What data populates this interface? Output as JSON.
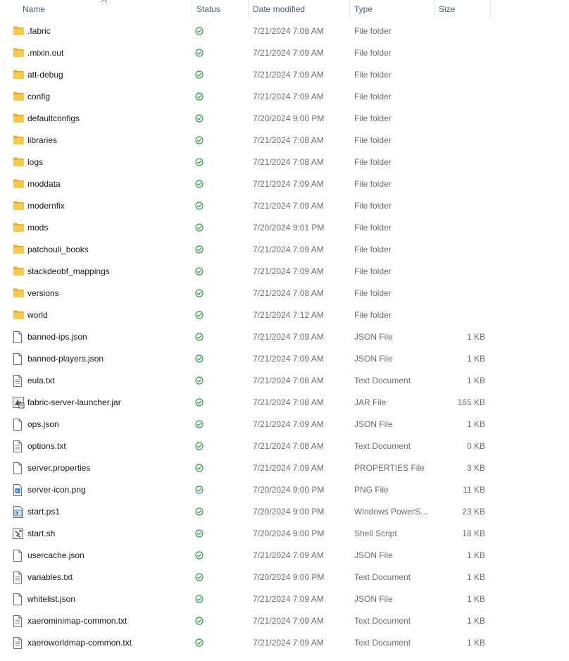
{
  "columns": {
    "name": "Name",
    "status": "Status",
    "date": "Date modified",
    "type": "Type",
    "size": "Size"
  },
  "colors": {
    "folder": "#f8c94a",
    "folder_dark": "#e6ab2a",
    "status_green": "#2e9c4a",
    "header_text": "#4c607a",
    "secondary_text": "#6d6d6d"
  },
  "files": [
    {
      "name": ".fabric",
      "icon": "folder-icon",
      "date": "7/21/2024 7:08 AM",
      "type": "File folder",
      "size": ""
    },
    {
      "name": ".mixin.out",
      "icon": "folder-icon",
      "date": "7/21/2024 7:09 AM",
      "type": "File folder",
      "size": ""
    },
    {
      "name": "att-debug",
      "icon": "folder-icon",
      "date": "7/21/2024 7:09 AM",
      "type": "File folder",
      "size": ""
    },
    {
      "name": "config",
      "icon": "folder-icon",
      "date": "7/21/2024 7:09 AM",
      "type": "File folder",
      "size": ""
    },
    {
      "name": "defaultconfigs",
      "icon": "folder-icon",
      "date": "7/20/2024 9:00 PM",
      "type": "File folder",
      "size": ""
    },
    {
      "name": "libraries",
      "icon": "folder-icon",
      "date": "7/21/2024 7:08 AM",
      "type": "File folder",
      "size": ""
    },
    {
      "name": "logs",
      "icon": "folder-icon",
      "date": "7/21/2024 7:08 AM",
      "type": "File folder",
      "size": ""
    },
    {
      "name": "moddata",
      "icon": "folder-icon",
      "date": "7/21/2024 7:09 AM",
      "type": "File folder",
      "size": ""
    },
    {
      "name": "modernfix",
      "icon": "folder-icon",
      "date": "7/21/2024 7:09 AM",
      "type": "File folder",
      "size": ""
    },
    {
      "name": "mods",
      "icon": "folder-icon",
      "date": "7/20/2024 9:01 PM",
      "type": "File folder",
      "size": ""
    },
    {
      "name": "patchouli_books",
      "icon": "folder-icon",
      "date": "7/21/2024 7:09 AM",
      "type": "File folder",
      "size": ""
    },
    {
      "name": "stackdeobf_mappings",
      "icon": "folder-icon",
      "date": "7/21/2024 7:09 AM",
      "type": "File folder",
      "size": ""
    },
    {
      "name": "versions",
      "icon": "folder-icon",
      "date": "7/21/2024 7:08 AM",
      "type": "File folder",
      "size": ""
    },
    {
      "name": "world",
      "icon": "folder-icon",
      "date": "7/21/2024 7:12 AM",
      "type": "File folder",
      "size": ""
    },
    {
      "name": "banned-ips.json",
      "icon": "document-icon",
      "date": "7/21/2024 7:09 AM",
      "type": "JSON File",
      "size": "1 KB"
    },
    {
      "name": "banned-players.json",
      "icon": "document-icon",
      "date": "7/21/2024 7:09 AM",
      "type": "JSON File",
      "size": "1 KB"
    },
    {
      "name": "eula.txt",
      "icon": "text-document-icon",
      "date": "7/21/2024 7:08 AM",
      "type": "Text Document",
      "size": "1 KB"
    },
    {
      "name": "fabric-server-launcher.jar",
      "icon": "jar-icon",
      "date": "7/21/2024 7:08 AM",
      "type": "JAR File",
      "size": "165 KB"
    },
    {
      "name": "ops.json",
      "icon": "document-icon",
      "date": "7/21/2024 7:09 AM",
      "type": "JSON File",
      "size": "1 KB"
    },
    {
      "name": "options.txt",
      "icon": "text-document-icon",
      "date": "7/21/2024 7:08 AM",
      "type": "Text Document",
      "size": "0 KB"
    },
    {
      "name": "server.properties",
      "icon": "blank-document-icon",
      "date": "7/21/2024 7:09 AM",
      "type": "PROPERTIES File",
      "size": "3 KB"
    },
    {
      "name": "server-icon.png",
      "icon": "image-file-icon",
      "date": "7/20/2024 9:00 PM",
      "type": "PNG File",
      "size": "11 KB"
    },
    {
      "name": "start.ps1",
      "icon": "powershell-script-icon",
      "date": "7/20/2024 9:00 PM",
      "type": "Windows PowerS...",
      "size": "23 KB"
    },
    {
      "name": "start.sh",
      "icon": "shell-script-icon",
      "date": "7/20/2024 9:00 PM",
      "type": "Shell Script",
      "size": "18 KB"
    },
    {
      "name": "usercache.json",
      "icon": "document-icon",
      "date": "7/21/2024 7:09 AM",
      "type": "JSON File",
      "size": "1 KB"
    },
    {
      "name": "variables.txt",
      "icon": "text-document-icon",
      "date": "7/20/2024 9:00 PM",
      "type": "Text Document",
      "size": "1 KB"
    },
    {
      "name": "whitelist.json",
      "icon": "document-icon",
      "date": "7/21/2024 7:09 AM",
      "type": "JSON File",
      "size": "1 KB"
    },
    {
      "name": "xaerominimap-common.txt",
      "icon": "text-document-icon",
      "date": "7/21/2024 7:09 AM",
      "type": "Text Document",
      "size": "1 KB"
    },
    {
      "name": "xaeroworldmap-common.txt",
      "icon": "text-document-icon",
      "date": "7/21/2024 7:09 AM",
      "type": "Text Document",
      "size": "1 KB"
    }
  ]
}
